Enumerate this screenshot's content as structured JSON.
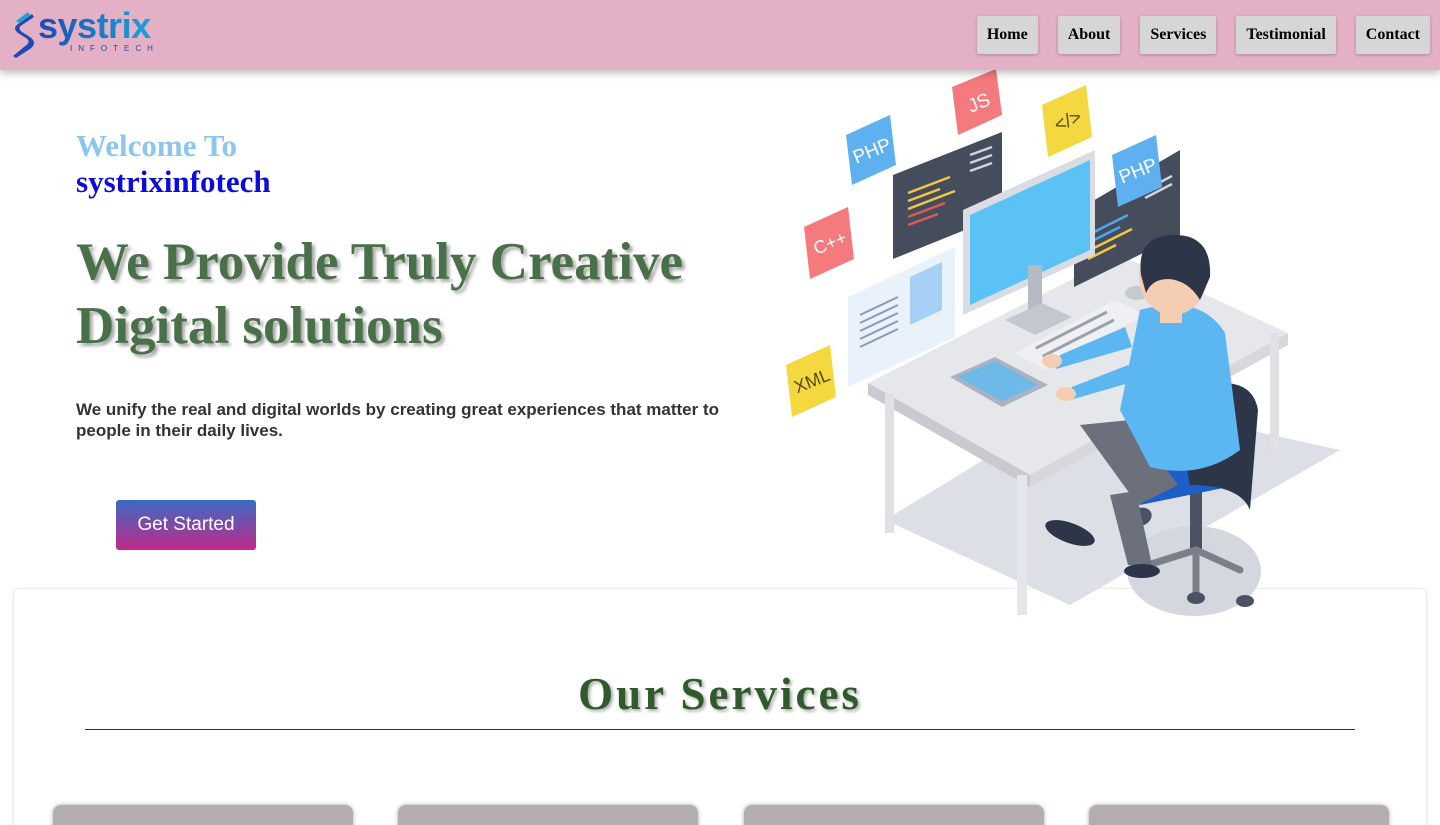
{
  "header": {
    "logo_text": "systrix",
    "logo_subtext": "INFOTECH",
    "nav": [
      "Home",
      "About",
      "Services",
      "Testimonial",
      "Contact"
    ]
  },
  "hero": {
    "welcome": "Welcome To",
    "brand": "systrixinfotech",
    "title": "We Provide Truly Creative Digital solutions",
    "description": "We unify the real and digital worlds by creating great experiences that matter to people in their daily lives.",
    "cta_label": "Get Started"
  },
  "illustration": {
    "tags": [
      "PHP",
      "JS",
      "</>",
      "PHP",
      "C++",
      "XML"
    ]
  },
  "services": {
    "title": "Our Services"
  },
  "colors": {
    "header_bg": "#e3b0c6",
    "welcome": "#8bc6ee",
    "brand": "#0b0bdc",
    "hero_title": "#4a7049",
    "services_title": "#2f5a2c",
    "cta_top": "#3a6bc4",
    "cta_bottom": "#c2298a"
  }
}
